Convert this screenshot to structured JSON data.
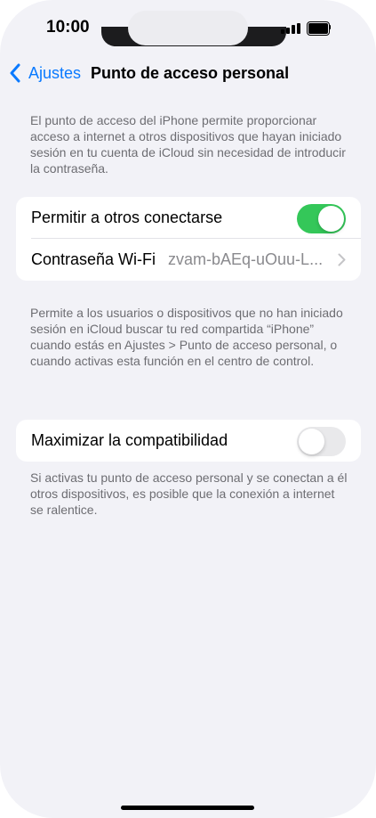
{
  "status": {
    "time": "10:00"
  },
  "nav": {
    "back_label": "Ajustes",
    "title": "Punto de acceso personal"
  },
  "intro_text": "El punto de acceso del iPhone permite proporcionar acceso a internet a otros dispositivos que hayan iniciado sesión en tu cuenta de iCloud sin necesidad de introducir la contraseña.",
  "group1": {
    "allow_label": "Permitir a otros conectarse",
    "allow_on": true,
    "wifi_label": "Contraseña Wi-Fi",
    "wifi_value": "zvam-bAEq-uOuu-L..."
  },
  "footnote1": "Permite a los usuarios o dispositivos que no han iniciado sesión en iCloud buscar tu red compartida “iPhone” cuando estás en Ajustes > Punto de acceso personal, o cuando activas esta función en el centro de control.",
  "group2": {
    "max_label": "Maximizar la compatibilidad",
    "max_on": false
  },
  "footnote2": "Si activas tu punto de acceso personal y se conectan a él otros dispositivos, es posible que la conexión a internet se ralentice.",
  "colors": {
    "accent": "#0a7aff",
    "toggle_on": "#34c759",
    "toggle_off": "#e9e9eb",
    "background": "#f2f2f7"
  },
  "icons": [
    "chevron-left-icon",
    "cellular-signal-icon",
    "battery-icon",
    "chevron-right-icon"
  ]
}
